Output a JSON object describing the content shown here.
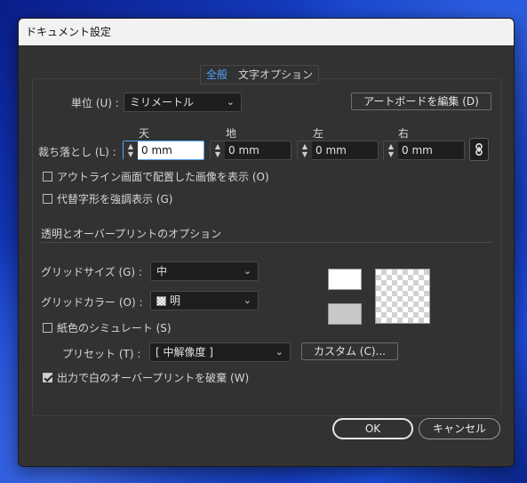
{
  "window": {
    "title": "ドキュメント設定"
  },
  "tabs": [
    {
      "label": "全般",
      "active": true
    },
    {
      "label": "文字オプション",
      "active": false
    }
  ],
  "units": {
    "label": "単位 (U) :",
    "value": "ミリメートル"
  },
  "edit_artboards_label": "アートボードを編集 (D)",
  "bleed": {
    "label": "裁ち落とし (L) :",
    "fields": [
      {
        "label": "天",
        "value": "0 mm"
      },
      {
        "label": "地",
        "value": "0 mm"
      },
      {
        "label": "左",
        "value": "0 mm"
      },
      {
        "label": "右",
        "value": "0 mm"
      }
    ]
  },
  "checkboxes": {
    "outline_images": {
      "label": "アウトライン画面で配置した画像を表示 (O)",
      "checked": false
    },
    "highlight_glyphs": {
      "label": "代替字形を強調表示 (G)",
      "checked": false
    }
  },
  "transparency": {
    "section_title": "透明とオーバープリントのオプション",
    "grid_size": {
      "label": "グリッドサイズ (G) :",
      "value": "中"
    },
    "grid_color": {
      "label": "グリッドカラー (O) :",
      "value": "明"
    },
    "simulate_paper": {
      "label": "紙色のシミュレート (S)",
      "checked": false
    },
    "preset": {
      "label": "プリセット (T) :",
      "value": "[ 中解像度 ]"
    },
    "custom_label": "カスタム (C)...",
    "discard_overprint": {
      "label": "出力で白のオーバープリントを破棄 (W)",
      "checked": true
    }
  },
  "footer": {
    "ok_label": "OK",
    "cancel_label": "キャンセル"
  },
  "colors": {
    "accent": "#4da3ff",
    "dialog_bg": "#323232",
    "field_bg": "#1e1e1e"
  }
}
